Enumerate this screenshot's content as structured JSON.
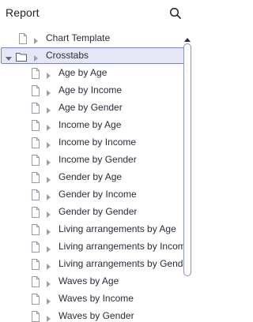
{
  "header": {
    "title": "Report",
    "search_icon": "search-icon"
  },
  "tree": {
    "items": [
      {
        "label": "Chart Template",
        "type": "document",
        "level": 0,
        "expanded": false,
        "selected": false
      },
      {
        "label": "Crosstabs",
        "type": "folder",
        "level": 0,
        "expanded": true,
        "selected": true
      },
      {
        "label": "Age by Age",
        "type": "document",
        "level": 1,
        "expanded": false,
        "selected": false
      },
      {
        "label": "Age by Income",
        "type": "document",
        "level": 1,
        "expanded": false,
        "selected": false
      },
      {
        "label": "Age by Gender",
        "type": "document",
        "level": 1,
        "expanded": false,
        "selected": false
      },
      {
        "label": "Income by Age",
        "type": "document",
        "level": 1,
        "expanded": false,
        "selected": false
      },
      {
        "label": "Income by Income",
        "type": "document",
        "level": 1,
        "expanded": false,
        "selected": false
      },
      {
        "label": "Income by Gender",
        "type": "document",
        "level": 1,
        "expanded": false,
        "selected": false
      },
      {
        "label": "Gender by Age",
        "type": "document",
        "level": 1,
        "expanded": false,
        "selected": false
      },
      {
        "label": "Gender by Income",
        "type": "document",
        "level": 1,
        "expanded": false,
        "selected": false
      },
      {
        "label": "Gender by Gender",
        "type": "document",
        "level": 1,
        "expanded": false,
        "selected": false
      },
      {
        "label": "Living arrangements by Age",
        "type": "document",
        "level": 1,
        "expanded": false,
        "selected": false
      },
      {
        "label": "Living arrangements by Income",
        "type": "document",
        "level": 1,
        "expanded": false,
        "selected": false
      },
      {
        "label": "Living arrangements by Gender",
        "type": "document",
        "level": 1,
        "expanded": false,
        "selected": false
      },
      {
        "label": "Waves by Age",
        "type": "document",
        "level": 1,
        "expanded": false,
        "selected": false
      },
      {
        "label": "Waves by Income",
        "type": "document",
        "level": 1,
        "expanded": false,
        "selected": false
      },
      {
        "label": "Waves by Gender",
        "type": "document",
        "level": 1,
        "expanded": false,
        "selected": false
      }
    ]
  },
  "colors": {
    "selection_bg": "#e6e7f6",
    "selection_border": "#7d80c4",
    "scrollbar": "#8a8fd0",
    "icon_gray": "#9a9aa6"
  }
}
